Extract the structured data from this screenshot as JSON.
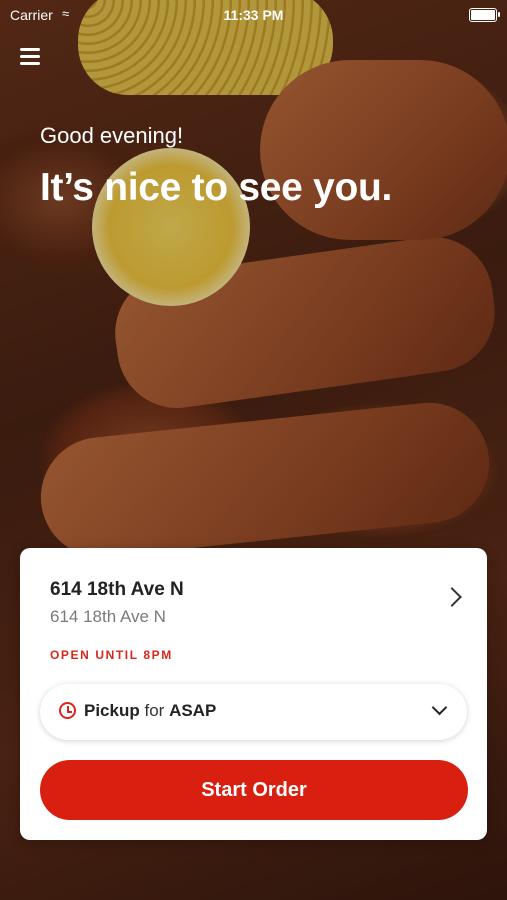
{
  "status_bar": {
    "carrier": "Carrier",
    "time": "11:33 PM"
  },
  "header": {
    "greeting": "Good evening!",
    "headline": "It’s nice to see you."
  },
  "location_card": {
    "title": "614 18th Ave N",
    "subtitle": "614 18th Ave N",
    "hours_status": "OPEN UNTIL 8PM",
    "order_type": "Pickup",
    "order_for_word": "for",
    "order_time": "ASAP",
    "cta_label": "Start Order"
  },
  "colors": {
    "accent": "#d91f0f",
    "card_bg": "#ffffff"
  },
  "icons": [
    "wifi-icon",
    "battery-icon",
    "hamburger-menu-icon",
    "chevron-right-icon",
    "clock-icon",
    "chevron-down-icon"
  ]
}
